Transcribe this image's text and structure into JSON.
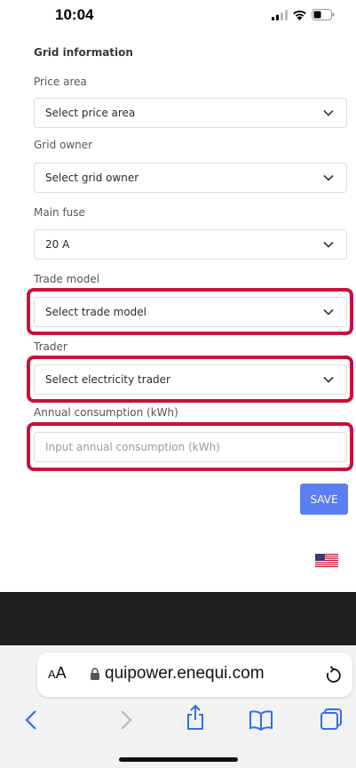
{
  "status_bar": {
    "time": "10:04",
    "icons": [
      "cellular-signal-icon",
      "wifi-icon",
      "battery-icon"
    ]
  },
  "form": {
    "section_title": "Grid information",
    "fields": [
      {
        "label": "Price area",
        "value": "Select price area",
        "type": "select"
      },
      {
        "label": "Grid owner",
        "value": "Select grid owner",
        "type": "select"
      },
      {
        "label": "Main fuse",
        "value": "20 A",
        "type": "select"
      },
      {
        "label": "Trade model",
        "value": "Select trade model",
        "type": "select",
        "highlighted": true
      },
      {
        "label": "Trader",
        "value": "Select electricity trader",
        "type": "select",
        "highlighted": true
      },
      {
        "label": "Annual consumption (kWh)",
        "placeholder": "Input annual consumption (kWh)",
        "type": "input",
        "highlighted": true
      }
    ],
    "save_label": "SAVE",
    "language_flag": "us-flag-icon"
  },
  "browser": {
    "text_size_label": "AA",
    "url": "quipower.enequi.com",
    "toolbar": [
      "back-icon",
      "forward-icon",
      "share-icon",
      "bookmarks-icon",
      "tabs-icon"
    ]
  },
  "colors": {
    "highlight": "#c8103c",
    "save_button": "#5b7ff0",
    "dark_band": "#1f1f21",
    "toolbar_accent": "#2f6fe8"
  }
}
